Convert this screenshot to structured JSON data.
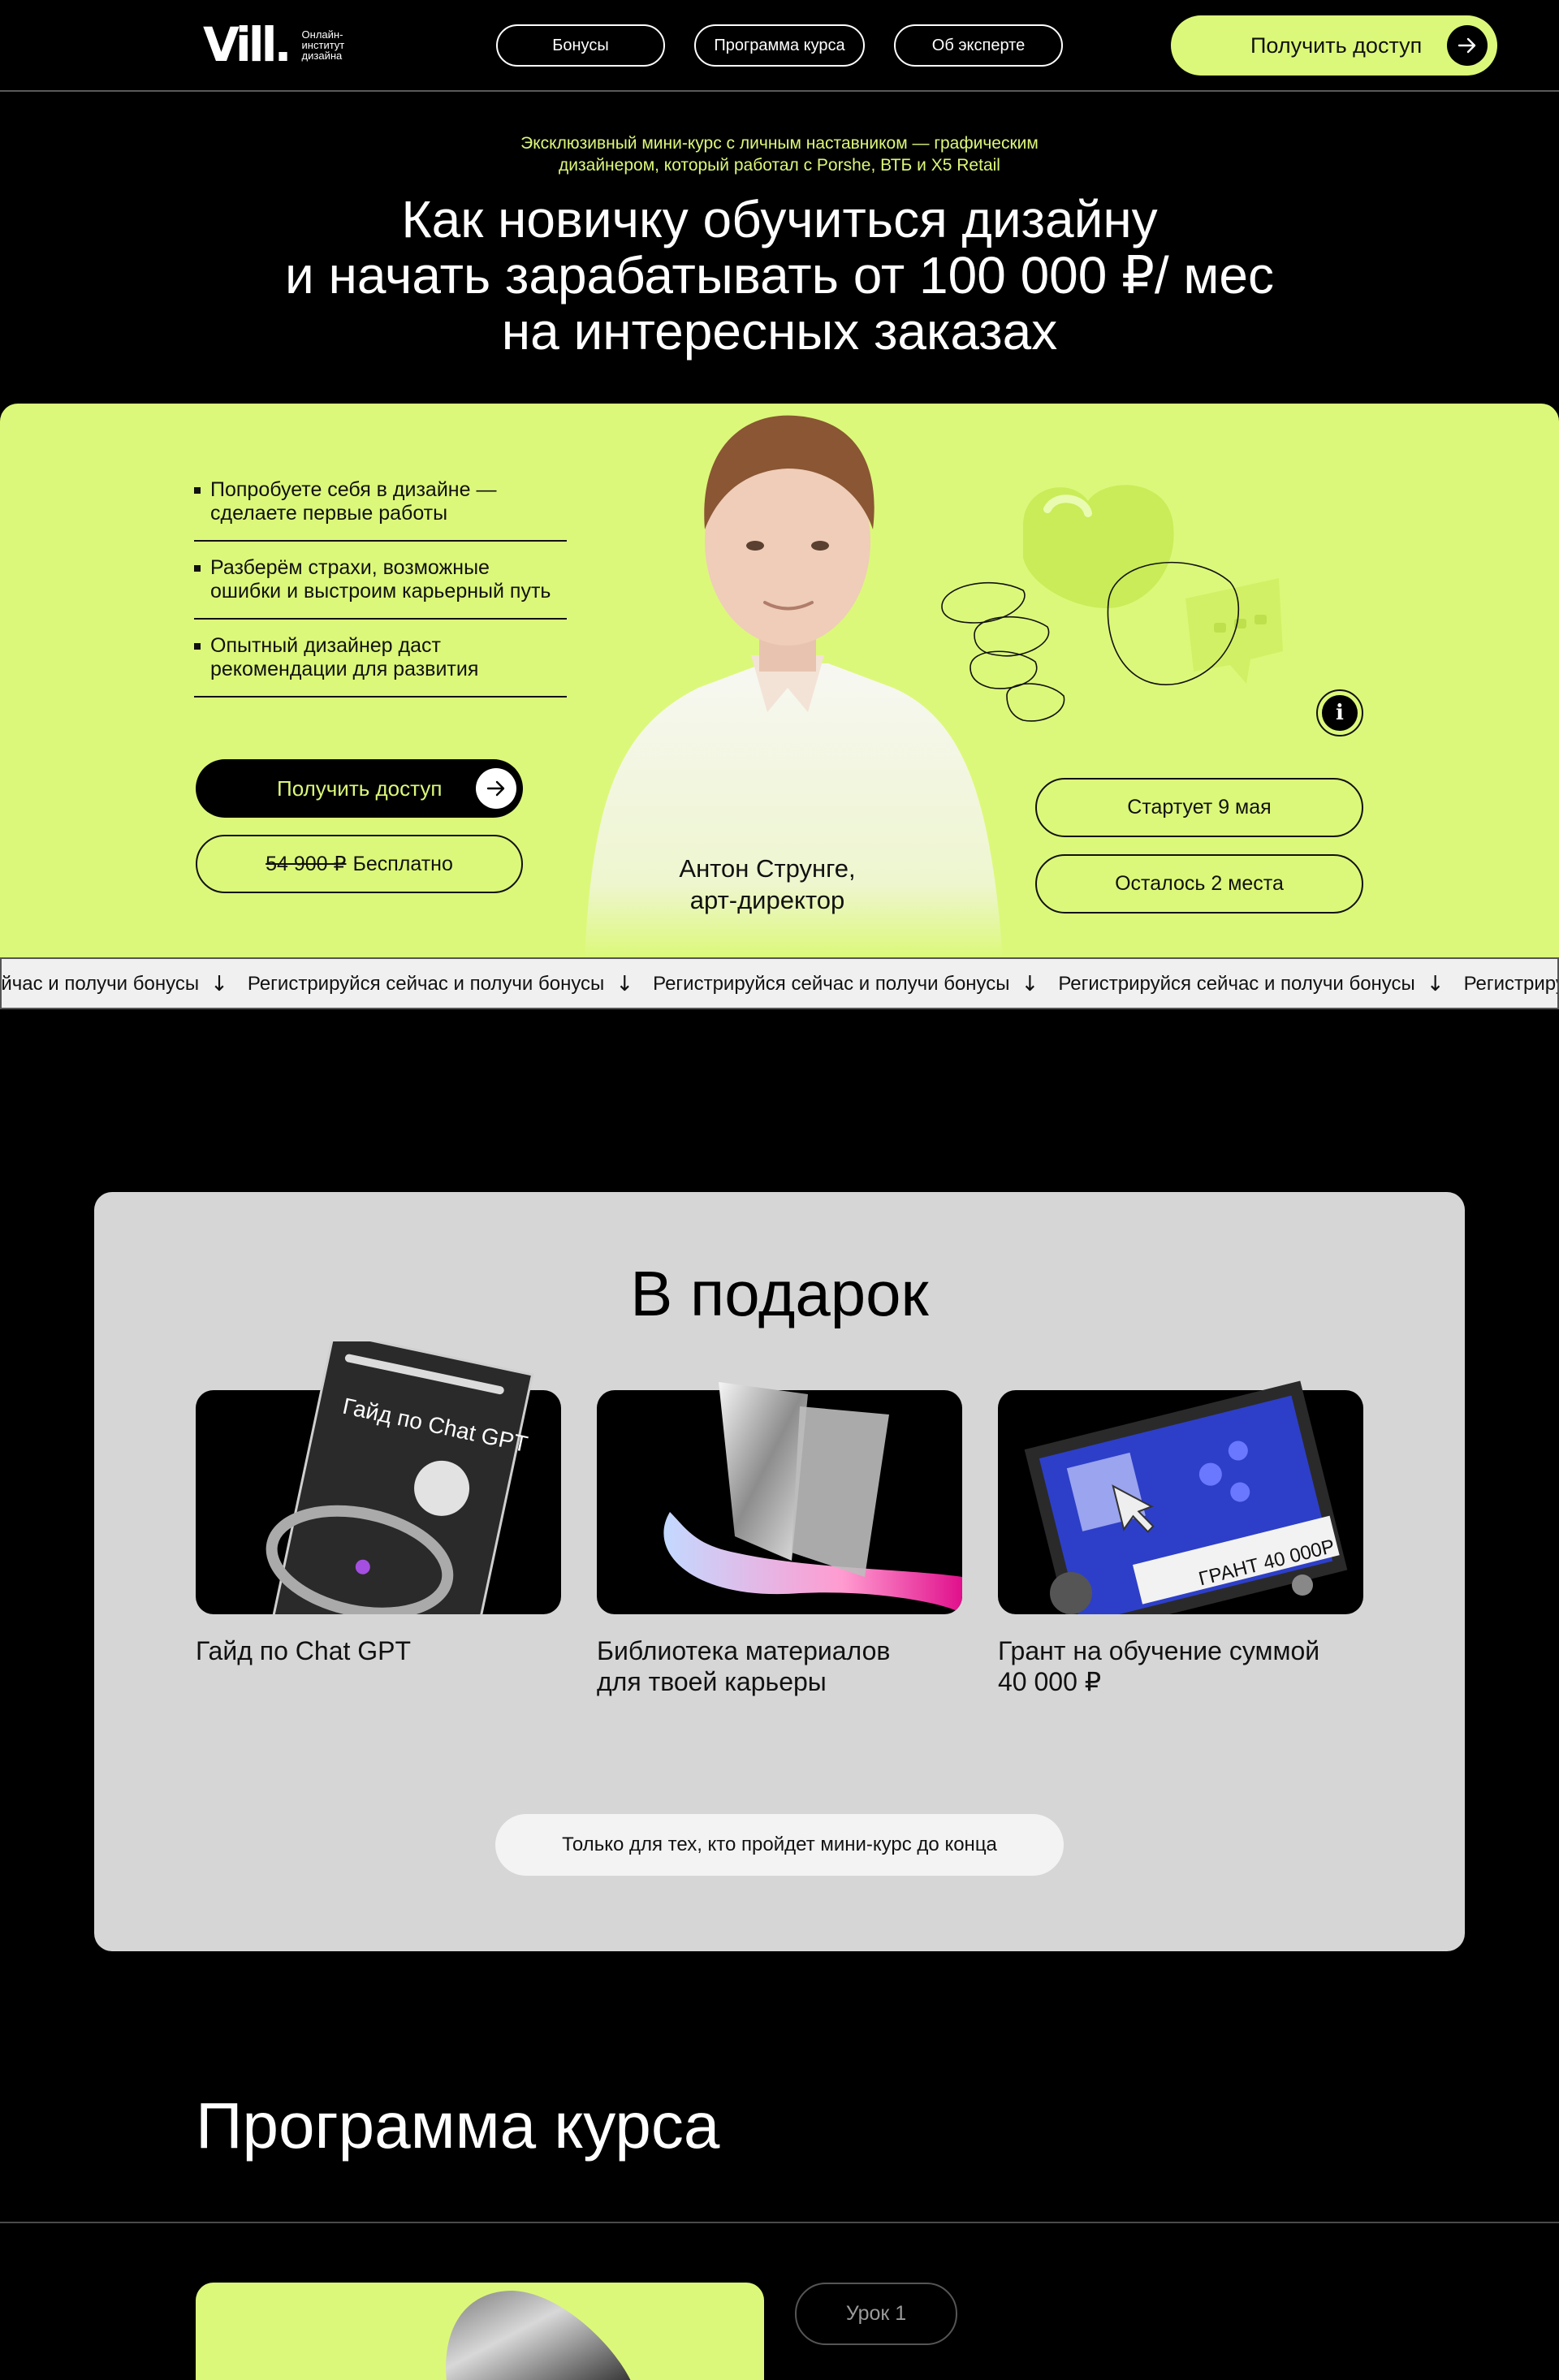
{
  "header": {
    "logo_mark": "Vill.",
    "logo_text": [
      "Онлайн-",
      "институт",
      "дизайна"
    ],
    "nav": [
      "Бонусы",
      "Программа курса",
      "Об эксперте"
    ],
    "cta_label": "Получить доступ"
  },
  "hero": {
    "subtitle_line1": "Эксклюзивный мини-курс с личным наставником — графическим",
    "subtitle_line2": "дизайнером, который работал с Porshe, ВТБ и X5 Retail",
    "title_line1": "Как новичку обучиться дизайну",
    "title_line2": "и начать зарабатывать от 100 000 ₽/ мес",
    "title_line3": "на интересных заказах",
    "bullets": [
      {
        "line1": "Попробуете себя в дизайне —",
        "line2": "сделаете первые работы"
      },
      {
        "line1": "Разберём страхи, возможные",
        "line2": "ошибки и выстроим карьерный путь"
      },
      {
        "line1": "Опытный дизайнер даст",
        "line2": "рекомендации для развития"
      }
    ],
    "access_button": "Получить доступ",
    "old_price": "54 900 ₽",
    "free_label": "Бесплатно",
    "person_name": "Антон Струнге,",
    "person_role": "арт-директор",
    "start_label": "Стартует 9 мая",
    "seats_label": "Осталось 2 места",
    "info_icon_glyph": "i"
  },
  "marquee": {
    "first_fragment": "ейчас и получи бонусы",
    "item": "Регистрируйся сейчас и получи бонусы"
  },
  "gifts": {
    "title": "В подарок",
    "cards": [
      {
        "line1": "Гайд по Chat GPT",
        "line2": "",
        "image_text": "Гайд по Chat GPT"
      },
      {
        "line1": "Библиотека материалов",
        "line2": "для твоей карьеры",
        "image_text": ""
      },
      {
        "line1": "Грант на обучение суммой",
        "line2": "40 000 ₽",
        "image_text": "ГРАНТ 40 000Р"
      }
    ],
    "note": "Только для тех, кто пройдет мини-курс до конца"
  },
  "program": {
    "title": "Программа курса",
    "lesson_label": "Урок 1"
  },
  "colors": {
    "accent": "#dcf87a",
    "background": "#000000",
    "gift_panel": "#d6d6d6"
  }
}
